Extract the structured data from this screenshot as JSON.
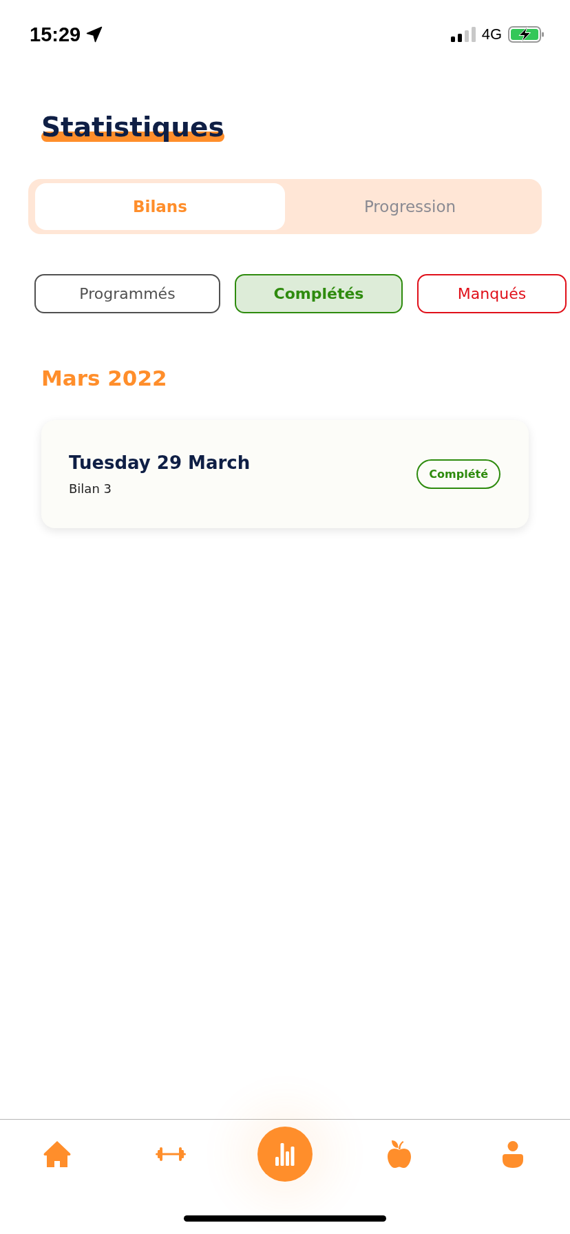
{
  "status_bar": {
    "time": "15:29",
    "network": "4G"
  },
  "header": {
    "title": "Statistiques"
  },
  "tabs": [
    {
      "label": "Bilans",
      "selected": true
    },
    {
      "label": "Progression",
      "selected": false
    }
  ],
  "filters": [
    {
      "label": "Programmés",
      "selected": false,
      "color": "#505050"
    },
    {
      "label": "Complétés",
      "selected": true,
      "color": "#2e8b0e"
    },
    {
      "label": "Manqués",
      "selected": false,
      "color": "#e0101a"
    }
  ],
  "sections": [
    {
      "month": "Mars 2022",
      "entries": [
        {
          "date": "Tuesday 29 March",
          "name": "Bilan 3",
          "status": "Complété"
        }
      ]
    }
  ],
  "bottom_nav": [
    {
      "selected": false
    },
    {
      "selected": false
    },
    {
      "selected": true
    },
    {
      "selected": false
    },
    {
      "selected": false
    }
  ]
}
